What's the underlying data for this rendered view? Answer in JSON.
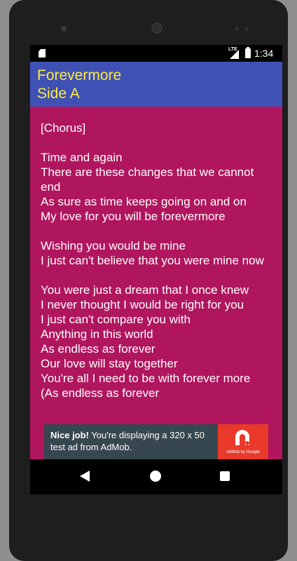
{
  "status_bar": {
    "network": "LTE",
    "time": "1:34"
  },
  "app_bar": {
    "title_line1": "Forevermore",
    "title_line2": "Side A"
  },
  "lyrics": "[Chorus]\n\nTime and again\nThere are these changes that we cannot end\nAs sure as time keeps going on and on\nMy love for you will be forevermore\n\nWishing you would be mine\nI just can't believe that you were mine now\n\nYou were just a dream that I once knew\nI never thought I would be right for you\nI just can't compare you with\nAnything in this world\nAs endless as forever\nOur love will stay together\nYou're all I need to be with forever more\n(As endless as forever",
  "ad": {
    "headline": "Nice job!",
    "body": " You're displaying a 320 x 50 test ad from AdMob.",
    "brand": "AdMob by Google",
    "logo_icon": "admob-logo-icon"
  },
  "nav": {
    "back_icon": "back-triangle-icon",
    "home_icon": "home-circle-icon",
    "recents_icon": "recents-square-icon"
  },
  "colors": {
    "app_bar": "#3f51b5",
    "title_text": "#ffeb3b",
    "content_bg": "#b0165e",
    "ad_bg": "#37474f",
    "ad_logo_bg": "#e8392b"
  }
}
